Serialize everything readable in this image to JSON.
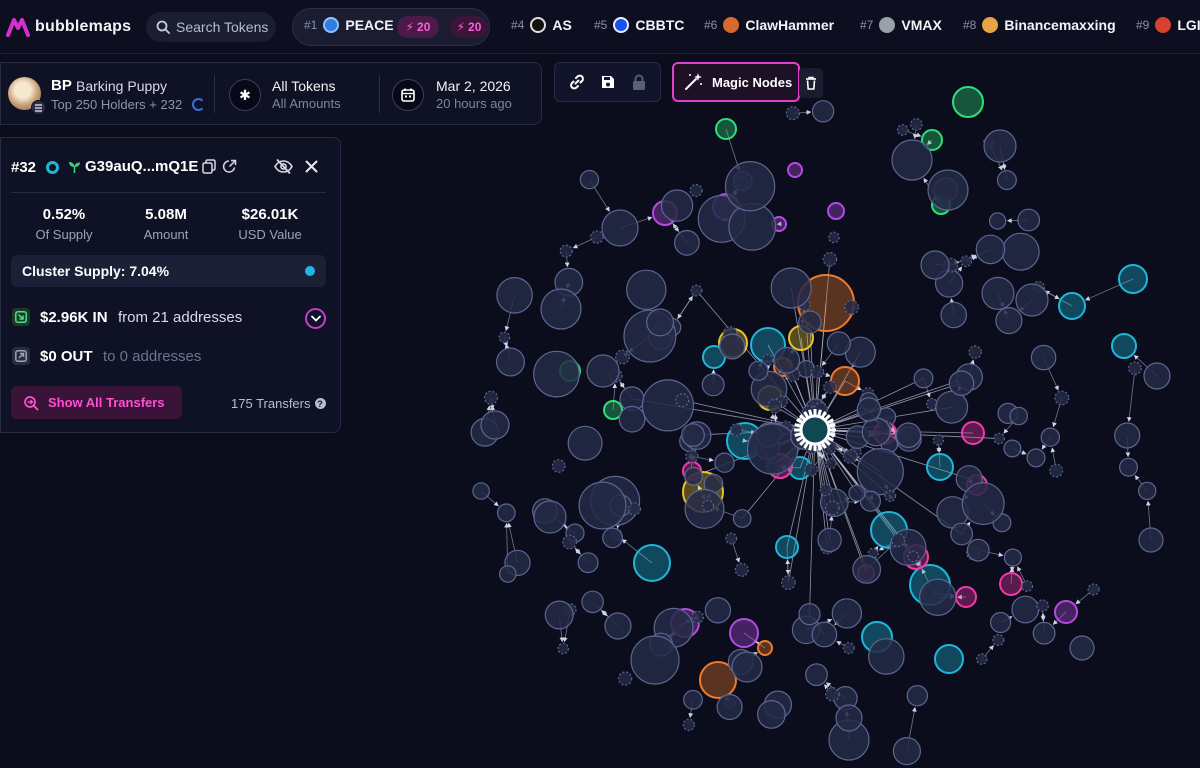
{
  "app": {
    "name": "bubblemaps"
  },
  "search": {
    "placeholder": "Search Tokens"
  },
  "trending": [
    {
      "rank": "#1",
      "symbol": "PEACE",
      "boost": "20",
      "boost2": "20"
    },
    {
      "rank": "#4",
      "symbol": "AS"
    },
    {
      "rank": "#5",
      "symbol": "CBBTC"
    },
    {
      "rank": "#6",
      "symbol": "ClawHammer"
    },
    {
      "rank": "#7",
      "symbol": "VMAX"
    },
    {
      "rank": "#8",
      "symbol": "Binancemaxxing"
    },
    {
      "rank": "#9",
      "symbol": "LGI"
    }
  ],
  "token": {
    "symbol": "BP",
    "name": "Barking Puppy",
    "holders": "Top 250 Holders + 232",
    "filter_title": "All Tokens",
    "filter_sub": "All Amounts",
    "date": "Mar 2, 2026",
    "date_ago": "20 hours ago"
  },
  "toolbar": {
    "magic_nodes": "Magic Nodes"
  },
  "wallet": {
    "rank": "#32",
    "address": "G39auQ...mQ1E",
    "supply_pct": "0.52%",
    "supply_lbl": "Of Supply",
    "amount": "5.08M",
    "amount_lbl": "Amount",
    "usd": "$26.01K",
    "usd_lbl": "USD Value",
    "cluster": "Cluster Supply: 7.04%",
    "in_amount": "$2.96K IN",
    "in_text": "from 21 addresses",
    "out_amount": "$0 OUT",
    "out_text": "to 0 addresses",
    "show_transfers": "Show All Transfers",
    "transfers_count": "175 Transfers"
  },
  "colors": {
    "background": "#0b0d1c",
    "accent_pink": "#e23fd0",
    "cyan": "#1fb6d8",
    "green": "#2ee07a",
    "orange": "#f07a2a",
    "yellow": "#e6c42a",
    "purple": "#b34be0",
    "magenta": "#f03aa8",
    "grey_bubble": "#2b3252"
  }
}
